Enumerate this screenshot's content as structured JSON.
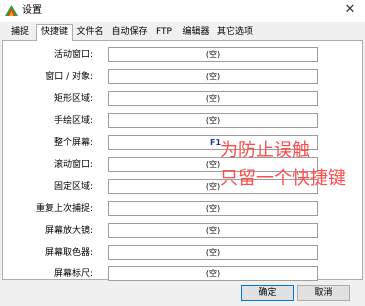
{
  "window": {
    "title": "设置",
    "close_glyph": "✕",
    "app_icon": "app-logo-icon"
  },
  "tabs": [
    {
      "label": "捕捉",
      "active": false
    },
    {
      "label": "快捷键",
      "active": true
    },
    {
      "label": "文件名",
      "active": false
    },
    {
      "label": "自动保存",
      "active": false
    },
    {
      "label": "FTP",
      "active": false
    },
    {
      "label": "编辑器",
      "active": false
    },
    {
      "label": "其它选项",
      "active": false
    }
  ],
  "hotkeys": [
    {
      "label": "活动窗口:",
      "value": "(空)"
    },
    {
      "label": "窗口 / 对象:",
      "value": "(空)"
    },
    {
      "label": "矩形区域:",
      "value": "(空)"
    },
    {
      "label": "手绘区域:",
      "value": "(空)"
    },
    {
      "label": "整个屏幕:",
      "value": "F1"
    },
    {
      "label": "滚动窗口:",
      "value": "(空)"
    },
    {
      "label": "固定区域:",
      "value": "(空)"
    },
    {
      "label": "重复上次捕捉:",
      "value": "(空)"
    },
    {
      "label": "屏幕放大镜:",
      "value": "(空)"
    },
    {
      "label": "屏幕取色器:",
      "value": "(空)"
    },
    {
      "label": "屏幕标尺:",
      "value": "(空)"
    }
  ],
  "annotation": {
    "line1": "为防止误触",
    "line2": "只留一个快捷键",
    "color": "#ff4d4f"
  },
  "buttons": {
    "ok": "确定",
    "cancel": "取消"
  }
}
